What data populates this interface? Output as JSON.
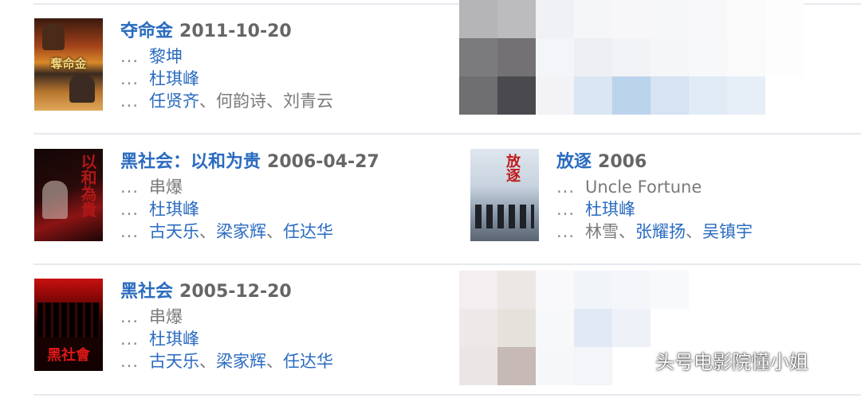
{
  "movies": [
    {
      "title": "夺命金",
      "date": "2011-10-20",
      "line1": "黎坤",
      "line2": "杜琪峰",
      "cast": [
        "任贤齐",
        "何韵诗",
        "刘青云"
      ],
      "poster_text": "奪命金"
    },
    {
      "title": "黑社会：以和为贵",
      "date": "2006-04-27",
      "line1": "串爆",
      "line2": "杜琪峰",
      "cast": [
        "古天乐",
        "梁家辉",
        "任达华"
      ],
      "poster_text": "以和為貴"
    },
    {
      "title": "放逐",
      "date": "2006",
      "line1": "Uncle Fortune",
      "line2": "杜琪峰",
      "cast": [
        "林雪",
        "张耀扬",
        "吴镇宇"
      ],
      "poster_text": "放逐"
    },
    {
      "title": "黑社会",
      "date": "2005-12-20",
      "line1": "串爆",
      "line2": "杜琪峰",
      "cast": [
        "古天乐",
        "梁家辉",
        "任达华"
      ],
      "poster_text": "黑社會"
    }
  ],
  "dots": "...",
  "separator": "、",
  "watermark": "头号电影院懂小姐",
  "colors": {
    "link": "#2a6bc0",
    "date": "#666666",
    "muted": "#7a7a7a"
  }
}
